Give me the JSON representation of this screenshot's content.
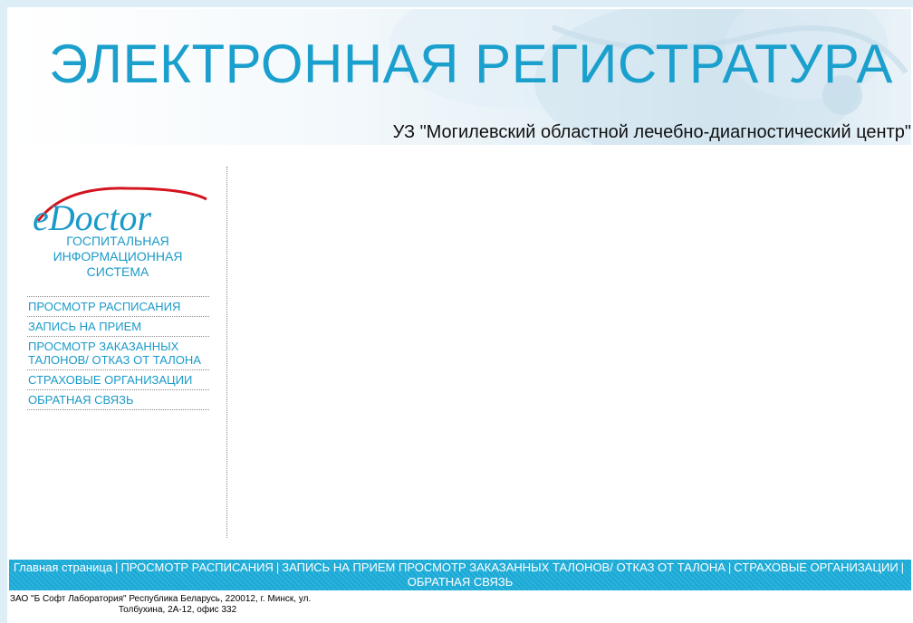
{
  "banner": {
    "title": "ЭЛЕКТРОННАЯ РЕГИСТРАТУРА",
    "subtitle": "УЗ \"Могилевский областной лечебно-диагностический центр\""
  },
  "logo": {
    "text": "eDoctor",
    "caption": [
      "ГОСПИТАЛЬНАЯ",
      "ИНФОРМАЦИОННАЯ",
      "СИСТЕМА"
    ]
  },
  "menu": {
    "items": [
      "ПРОСМОТР РАСПИСАНИЯ",
      "ЗАПИСЬ НА ПРИЕМ",
      "ПРОСМОТР ЗАКАЗАННЫХ ТАЛОНОВ/ ОТКАЗ ОТ ТАЛОНА",
      "СТРАХОВЫЕ ОРГАНИЗАЦИИ",
      "ОБРАТНАЯ СВЯЗЬ"
    ]
  },
  "footer": {
    "home": "Главная страница",
    "schedule": "ПРОСМОТР РАСПИСАНИЯ",
    "appointment": "ЗАПИСЬ НА ПРИЕМ",
    "tickets": "ПРОСМОТР ЗАКАЗАННЫХ ТАЛОНОВ/ ОТКАЗ ОТ ТАЛОНА",
    "insurance": "СТРАХОВЫЕ ОРГАНИЗАЦИИ",
    "feedback": "ОБРАТНАЯ СВЯЗЬ",
    "separator": "|",
    "copyright_line1": "ЗАО \"Б Софт Лаборатория\" Республика Беларусь, 220012, г. Минск, ул.",
    "copyright_line2": "Толбухина, 2А-12, офис 332"
  },
  "colors": {
    "accent": "#1ba0cd",
    "footer_bg": "#1ba8d4",
    "page_bg": "#ddeef6"
  }
}
